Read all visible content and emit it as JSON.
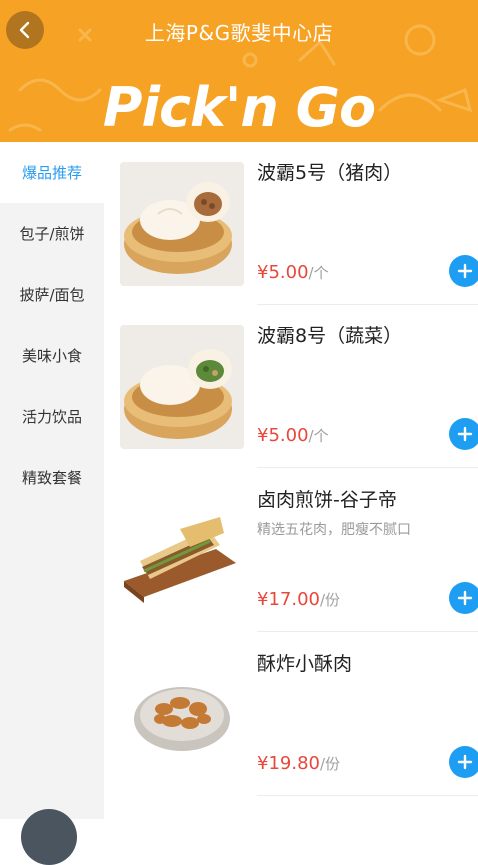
{
  "header": {
    "store_name": "上海P&G歌斐中心店",
    "brand": "Pick'n Go",
    "back_icon": "chevron-left-icon",
    "bg_color": "#f6a224"
  },
  "sidebar": {
    "items": [
      {
        "label": "爆品推荐",
        "active": true
      },
      {
        "label": "包子/煎饼",
        "active": false
      },
      {
        "label": "披萨/面包",
        "active": false
      },
      {
        "label": "美味小食",
        "active": false
      },
      {
        "label": "活力饮品",
        "active": false
      },
      {
        "label": "精致套餐",
        "active": false
      }
    ],
    "active_color": "#2a9cf0"
  },
  "products": [
    {
      "name": "波霸5号（猪肉）",
      "desc": "",
      "currency": "¥",
      "price": "5.00",
      "unit": "/个",
      "image": "steamed-bun-pork-image"
    },
    {
      "name": "波霸8号（蔬菜）",
      "desc": "",
      "currency": "¥",
      "price": "5.00",
      "unit": "/个",
      "image": "steamed-bun-vegetable-image"
    },
    {
      "name": "卤肉煎饼-谷子帝",
      "desc": "精选五花肉，肥瘦不腻口",
      "currency": "¥",
      "price": "17.00",
      "unit": "/份",
      "image": "jianbing-image"
    },
    {
      "name": "酥炸小酥肉",
      "desc": "",
      "currency": "¥",
      "price": "19.80",
      "unit": "/份",
      "image": "fried-pork-image"
    }
  ],
  "colors": {
    "price": "#e8473b",
    "add_button": "#1e9ef2"
  }
}
